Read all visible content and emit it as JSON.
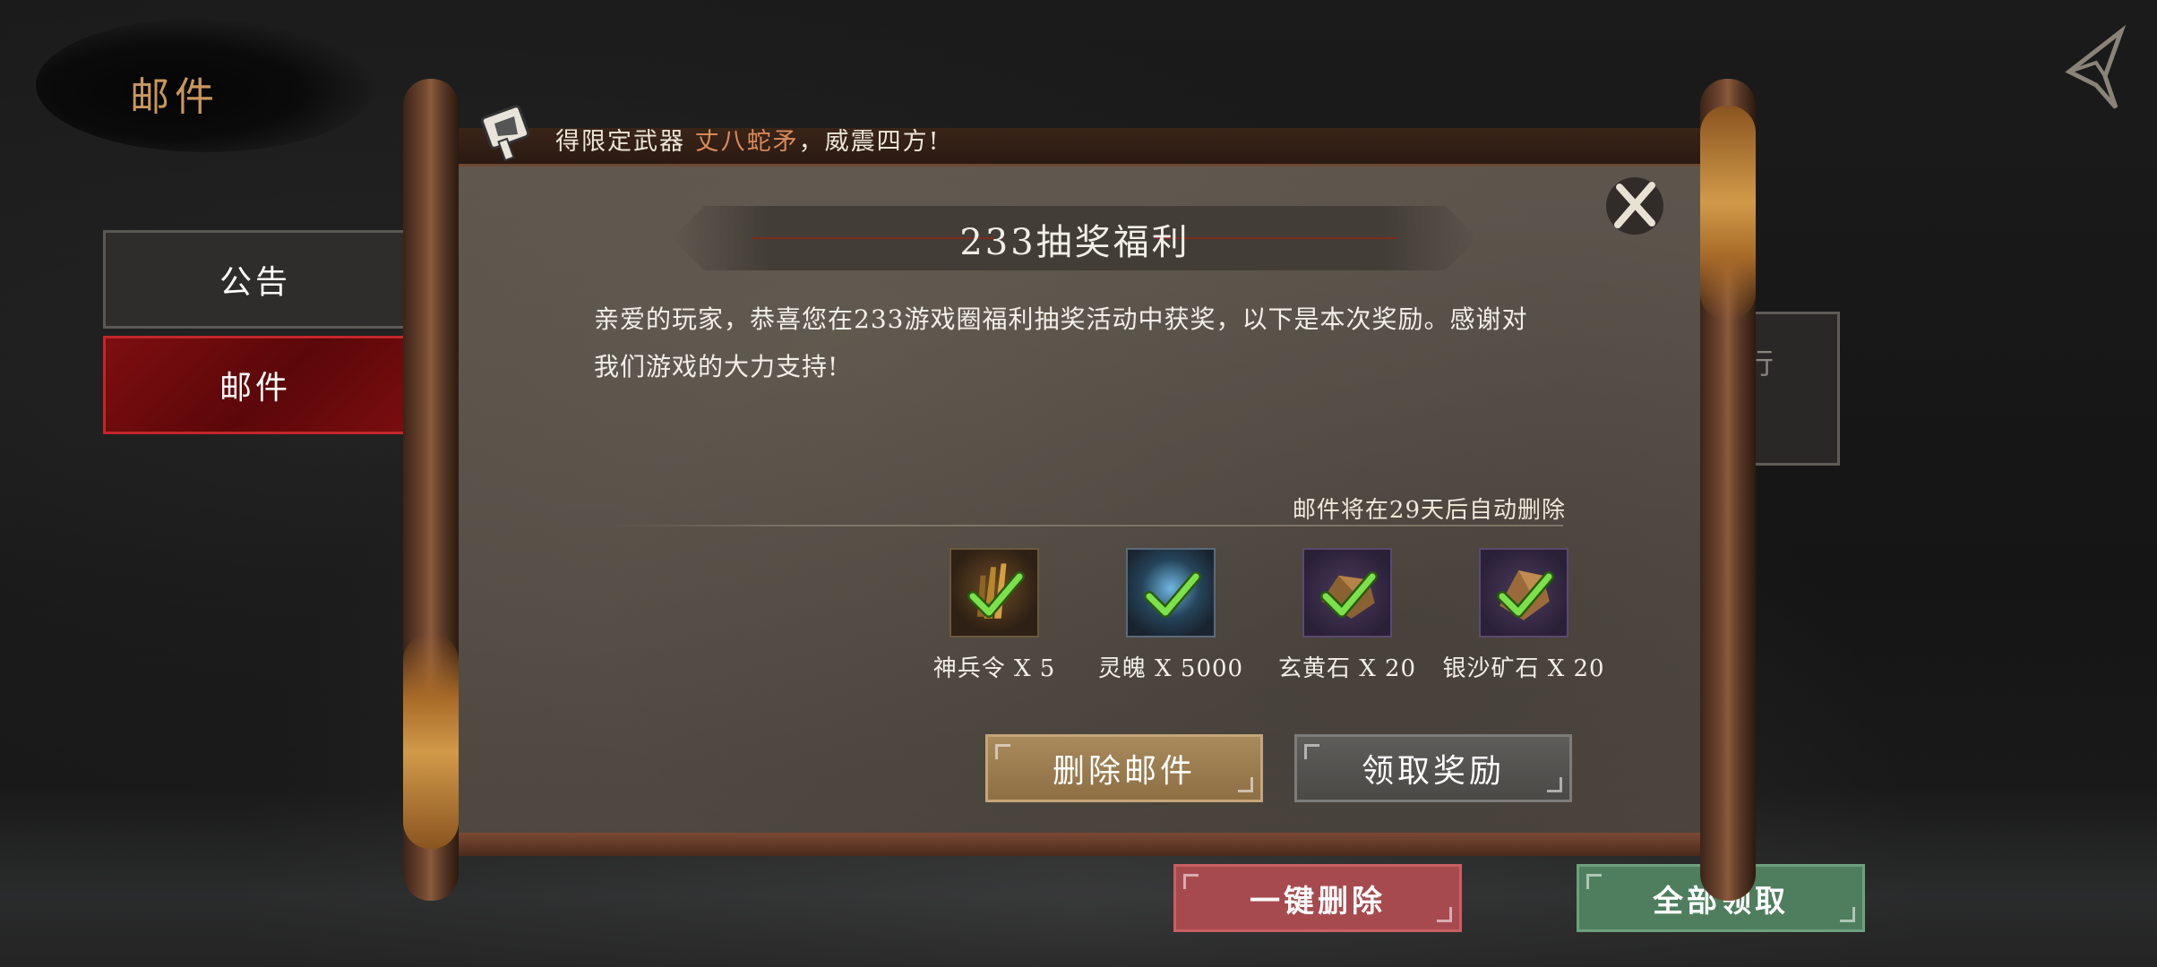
{
  "header": {
    "title": "邮件"
  },
  "sidebar": {
    "tabs": [
      {
        "label": "公告",
        "active": false
      },
      {
        "label": "邮件",
        "active": true
      }
    ]
  },
  "ticker": {
    "prefix": "得限定武器 ",
    "highlight": "丈八蛇矛",
    "suffix": "，威震四方!"
  },
  "mail": {
    "title": "233抽奖福利",
    "body": "亲爱的玩家，恭喜您在233游戏圈福利抽奖活动中获奖，以下是本次奖励。感谢对我们游戏的大力支持!",
    "expiry_note": "邮件将在29天后自动删除",
    "rewards": [
      {
        "label": "神兵令 X 5",
        "icon": "weapon-token-icon",
        "claimed": true
      },
      {
        "label": "灵魄 X 5000",
        "icon": "spirit-soul-icon",
        "claimed": true
      },
      {
        "label": "玄黄石 X 20",
        "icon": "xuanhuang-stone-icon",
        "claimed": true
      },
      {
        "label": "银沙矿石 X 20",
        "icon": "silver-sand-ore-icon",
        "claimed": true
      }
    ],
    "actions": {
      "delete_label": "删除邮件",
      "claim_label": "领取奖励"
    }
  },
  "peek_panel": {
    "text": "行"
  },
  "footer": {
    "delete_all_label": "一键删除",
    "claim_all_label": "全部领取"
  },
  "colors": {
    "accent_gold": "#c9975c",
    "tab_active": "#7e0e10",
    "delete_all": "#a64a4e",
    "claim_all": "#4e7e5e",
    "highlight_text": "#d98b5a",
    "check_green": "#7ce14a"
  }
}
